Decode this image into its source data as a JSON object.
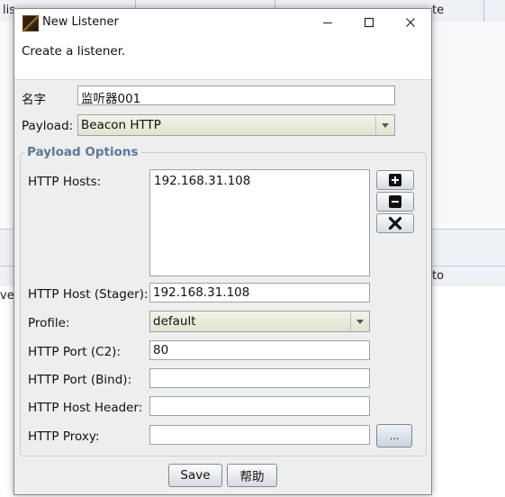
{
  "background": {
    "top_headers": [
      "lis",
      "te"
    ],
    "bottom_headers": [
      "to"
    ],
    "row_fragment": "ve"
  },
  "dialog": {
    "title": "New Listener",
    "controls": {
      "minimize": "—",
      "maximize": "☐",
      "close": "✕"
    },
    "description": "Create a listener.",
    "name": {
      "label": "名字",
      "value": "监听器001"
    },
    "payload": {
      "label": "Payload:",
      "value": "Beacon HTTP"
    },
    "options": {
      "title": "Payload Options",
      "http_hosts": {
        "label": "HTTP Hosts:",
        "items": [
          "192.168.31.108"
        ]
      },
      "http_host_stager": {
        "label": "HTTP Host (Stager):",
        "value": "192.168.31.108"
      },
      "profile": {
        "label": "Profile:",
        "value": "default"
      },
      "http_port_c2": {
        "label": "HTTP Port (C2):",
        "value": "80"
      },
      "http_port_bind": {
        "label": "HTTP Port (Bind):",
        "value": ""
      },
      "http_host_header": {
        "label": "HTTP Host Header:",
        "value": ""
      },
      "http_proxy": {
        "label": "HTTP Proxy:",
        "value": "",
        "button": "..."
      }
    },
    "buttons": {
      "save": "Save",
      "help": "帮助"
    }
  }
}
